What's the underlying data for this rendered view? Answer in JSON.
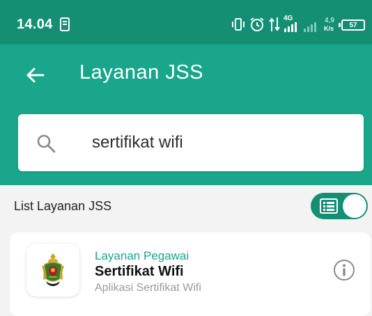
{
  "status_bar": {
    "time": "14.04",
    "network_type": "4G",
    "speed_value": "4,9",
    "speed_unit": "K/s",
    "battery_level": "57",
    "icons": [
      "notification-icon",
      "vibrate-icon",
      "alarm-icon",
      "data-transfer-icon",
      "signal-icon",
      "battery-icon"
    ]
  },
  "header": {
    "title": "Layanan JSS",
    "back_icon": "arrow-left-icon"
  },
  "search": {
    "value": "sertifikat wifi",
    "icon": "search-icon"
  },
  "list": {
    "title": "List Layanan JSS",
    "view_toggle_on": true,
    "toggle_icon": "list-view-icon"
  },
  "results": [
    {
      "category": "Layanan Pegawai",
      "title": "Sertifikat Wifi",
      "description": "Aplikasi Sertifikat Wifi",
      "logo": "jogja-emblem-logo",
      "action_icon": "info-icon"
    }
  ],
  "colors": {
    "status_bar": "#148f74",
    "primary": "#1aa68a",
    "background": "#f3f3f3",
    "card": "#ffffff"
  }
}
